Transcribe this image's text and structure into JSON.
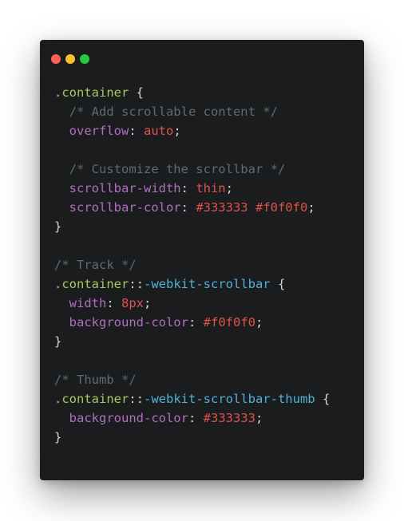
{
  "window": {
    "controls": [
      {
        "name": "close",
        "color": "#ff5f56"
      },
      {
        "name": "minimize",
        "color": "#ffbd2e"
      },
      {
        "name": "maximize",
        "color": "#27c93f"
      }
    ]
  },
  "code": {
    "lines": [
      [
        {
          "t": ".container",
          "c": "selector"
        },
        {
          "t": " {",
          "c": "punct"
        }
      ],
      [
        {
          "t": "  /* Add scrollable content */",
          "c": "comment"
        }
      ],
      [
        {
          "t": "  overflow",
          "c": "prop"
        },
        {
          "t": ": ",
          "c": "punct"
        },
        {
          "t": "auto",
          "c": "value"
        },
        {
          "t": ";",
          "c": "punct"
        }
      ],
      [],
      [
        {
          "t": "  /* Customize the scrollbar */",
          "c": "comment"
        }
      ],
      [
        {
          "t": "  scrollbar-width",
          "c": "prop"
        },
        {
          "t": ": ",
          "c": "punct"
        },
        {
          "t": "thin",
          "c": "value"
        },
        {
          "t": ";",
          "c": "punct"
        }
      ],
      [
        {
          "t": "  scrollbar-color",
          "c": "prop"
        },
        {
          "t": ": ",
          "c": "punct"
        },
        {
          "t": "#333333",
          "c": "hex"
        },
        {
          "t": " ",
          "c": "punct"
        },
        {
          "t": "#f0f0f0",
          "c": "hex"
        },
        {
          "t": ";",
          "c": "punct"
        }
      ],
      [
        {
          "t": "}",
          "c": "punct"
        }
      ],
      [],
      [
        {
          "t": "/* Track */",
          "c": "comment"
        }
      ],
      [
        {
          "t": ".container",
          "c": "selector"
        },
        {
          "t": "::",
          "c": "punct"
        },
        {
          "t": "-webkit-scrollbar",
          "c": "pseudo"
        },
        {
          "t": " {",
          "c": "punct"
        }
      ],
      [
        {
          "t": "  width",
          "c": "prop"
        },
        {
          "t": ": ",
          "c": "punct"
        },
        {
          "t": "8px",
          "c": "value"
        },
        {
          "t": ";",
          "c": "punct"
        }
      ],
      [
        {
          "t": "  background-color",
          "c": "prop"
        },
        {
          "t": ": ",
          "c": "punct"
        },
        {
          "t": "#f0f0f0",
          "c": "hex"
        },
        {
          "t": ";",
          "c": "punct"
        }
      ],
      [
        {
          "t": "}",
          "c": "punct"
        }
      ],
      [],
      [
        {
          "t": "/* Thumb */",
          "c": "comment"
        }
      ],
      [
        {
          "t": ".container",
          "c": "selector"
        },
        {
          "t": "::",
          "c": "punct"
        },
        {
          "t": "-webkit-scrollbar-thumb",
          "c": "pseudo"
        },
        {
          "t": " {",
          "c": "punct"
        }
      ],
      [
        {
          "t": "  background-color",
          "c": "prop"
        },
        {
          "t": ": ",
          "c": "punct"
        },
        {
          "t": "#333333",
          "c": "hex"
        },
        {
          "t": ";",
          "c": "punct"
        }
      ],
      [
        {
          "t": "}",
          "c": "punct"
        }
      ]
    ]
  }
}
